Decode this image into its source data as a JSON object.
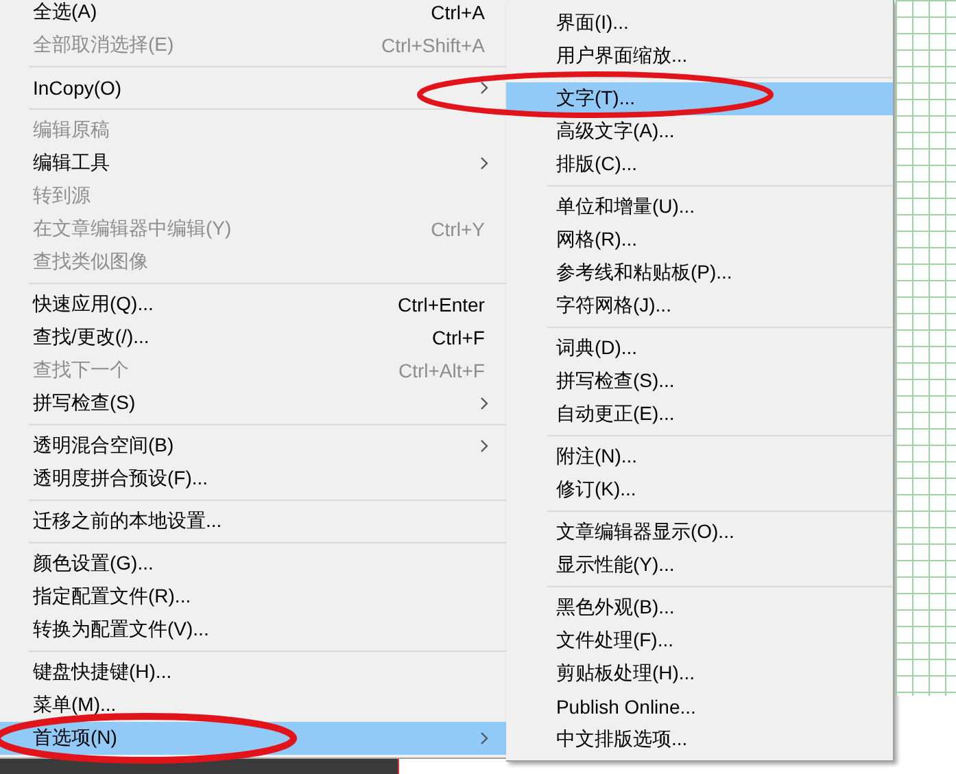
{
  "menu": {
    "groups": [
      [
        {
          "label": "全选(A)",
          "shortcut": "Ctrl+A",
          "disabled": false,
          "submenu": false,
          "selected": false
        },
        {
          "label": "全部取消选择(E)",
          "shortcut": "Ctrl+Shift+A",
          "disabled": true,
          "submenu": false,
          "selected": false
        }
      ],
      [
        {
          "label": "InCopy(O)",
          "disabled": false,
          "submenu": true,
          "selected": false
        }
      ],
      [
        {
          "label": "编辑原稿",
          "disabled": true,
          "submenu": false,
          "selected": false
        },
        {
          "label": "编辑工具",
          "disabled": false,
          "submenu": true,
          "selected": false
        },
        {
          "label": "转到源",
          "disabled": true,
          "submenu": false,
          "selected": false
        },
        {
          "label": "在文章编辑器中编辑(Y)",
          "shortcut": "Ctrl+Y",
          "disabled": true,
          "submenu": false,
          "selected": false
        },
        {
          "label": "查找类似图像",
          "disabled": true,
          "submenu": false,
          "selected": false
        }
      ],
      [
        {
          "label": "快速应用(Q)...",
          "shortcut": "Ctrl+Enter",
          "disabled": false,
          "submenu": false,
          "selected": false
        },
        {
          "label": "查找/更改(/)...",
          "shortcut": "Ctrl+F",
          "disabled": false,
          "submenu": false,
          "selected": false
        },
        {
          "label": "查找下一个",
          "shortcut": "Ctrl+Alt+F",
          "disabled": true,
          "submenu": false,
          "selected": false
        },
        {
          "label": "拼写检查(S)",
          "disabled": false,
          "submenu": true,
          "selected": false
        }
      ],
      [
        {
          "label": "透明混合空间(B)",
          "disabled": false,
          "submenu": true,
          "selected": false
        },
        {
          "label": "透明度拼合预设(F)...",
          "disabled": false,
          "submenu": false,
          "selected": false
        }
      ],
      [
        {
          "label": "迁移之前的本地设置...",
          "disabled": false,
          "submenu": false,
          "selected": false
        }
      ],
      [
        {
          "label": "颜色设置(G)...",
          "disabled": false,
          "submenu": false,
          "selected": false
        },
        {
          "label": "指定配置文件(R)...",
          "disabled": false,
          "submenu": false,
          "selected": false
        },
        {
          "label": "转换为配置文件(V)...",
          "disabled": false,
          "submenu": false,
          "selected": false
        }
      ],
      [
        {
          "label": "键盘快捷键(H)...",
          "disabled": false,
          "submenu": false,
          "selected": false
        },
        {
          "label": "菜单(M)...",
          "disabled": false,
          "submenu": false,
          "selected": false
        },
        {
          "label": "首选项(N)",
          "disabled": false,
          "submenu": true,
          "selected": true
        }
      ]
    ]
  },
  "submenu": {
    "groups": [
      [
        {
          "label": "界面(I)...",
          "selected": false
        },
        {
          "label": "用户界面缩放...",
          "selected": false
        }
      ],
      [
        {
          "label": "文字(T)...",
          "selected": true
        },
        {
          "label": "高级文字(A)...",
          "selected": false
        },
        {
          "label": "排版(C)...",
          "selected": false
        }
      ],
      [
        {
          "label": "单位和增量(U)...",
          "selected": false
        },
        {
          "label": "网格(R)...",
          "selected": false
        },
        {
          "label": "参考线和粘贴板(P)...",
          "selected": false
        },
        {
          "label": "字符网格(J)...",
          "selected": false
        }
      ],
      [
        {
          "label": "词典(D)...",
          "selected": false
        },
        {
          "label": "拼写检查(S)...",
          "selected": false
        },
        {
          "label": "自动更正(E)...",
          "selected": false
        }
      ],
      [
        {
          "label": "附注(N)...",
          "selected": false
        },
        {
          "label": "修订(K)...",
          "selected": false
        }
      ],
      [
        {
          "label": "文章编辑器显示(O)...",
          "selected": false
        },
        {
          "label": "显示性能(Y)...",
          "selected": false
        }
      ],
      [
        {
          "label": "黑色外观(B)...",
          "selected": false
        },
        {
          "label": "文件处理(F)...",
          "selected": false
        },
        {
          "label": "剪贴板处理(H)...",
          "selected": false
        },
        {
          "label": "Publish Online...",
          "selected": false
        },
        {
          "label": "中文排版选项...",
          "selected": false
        }
      ]
    ]
  }
}
